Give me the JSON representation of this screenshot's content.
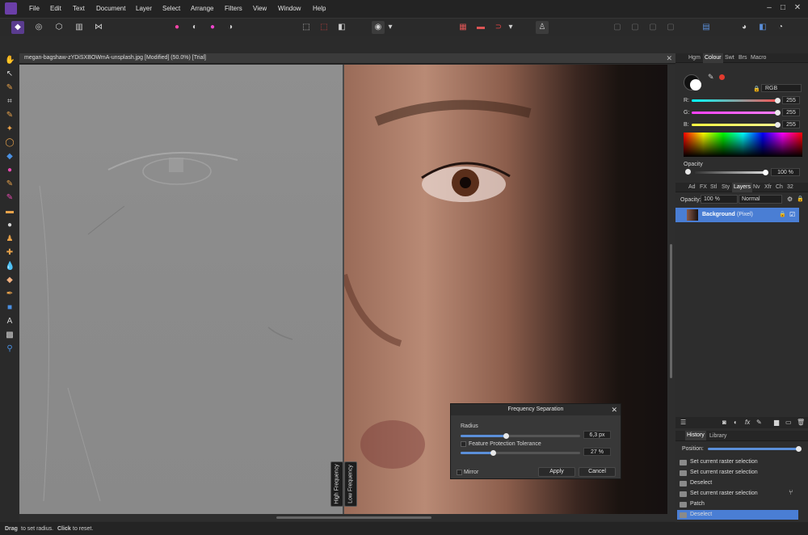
{
  "menu": {
    "items": [
      "File",
      "Edit",
      "Text",
      "Document",
      "Layer",
      "Select",
      "Arrange",
      "Filters",
      "View",
      "Window",
      "Help"
    ]
  },
  "document": {
    "tab_title": "megan-bagshaw-zYDiSXBOWmA-unsplash.jpg [Modified] (50.0%) [Trial]"
  },
  "preview_labels": {
    "high": "High Frequency",
    "low": "Low Frequency"
  },
  "dialog": {
    "title": "Frequency Separation",
    "radius_label": "Radius",
    "radius_value": "6,3 px",
    "radius_fraction": 0.38,
    "tolerance_label": "Feature Protection Tolerance",
    "tolerance_value": "27 %",
    "tolerance_fraction": 0.27,
    "mirror_label": "Mirror",
    "apply_label": "Apply",
    "cancel_label": "Cancel"
  },
  "colour_panel": {
    "tabs": [
      "Hgm",
      "Colour",
      "Swt",
      "Brs",
      "Macro"
    ],
    "active_tab": "Colour",
    "mode": "RGB",
    "channels": [
      {
        "label": "R:",
        "value": "255",
        "color": "#ff5050"
      },
      {
        "label": "G:",
        "value": "255",
        "color": "#3adf3a"
      },
      {
        "label": "B:",
        "value": "255",
        "color": "#4a7dff"
      }
    ],
    "opacity_label": "Opacity",
    "opacity_value": "100 %"
  },
  "layers_panel": {
    "tabs": [
      "Ad",
      "FX",
      "Stl",
      "Sty",
      "Layers",
      "Nv",
      "Xfr",
      "Ch",
      "32"
    ],
    "active_tab": "Layers",
    "opacity_label": "Opacity:",
    "opacity_value": "100 %",
    "blend_mode": "Normal",
    "layer_name": "Background",
    "layer_type": "(Pixel)"
  },
  "history_panel": {
    "tabs": [
      "History",
      "Library"
    ],
    "active_tab": "History",
    "position_label": "Position:",
    "items": [
      "Set current raster selection",
      "Set current raster selection",
      "Deselect",
      "Set current raster selection",
      "Patch",
      "Deselect"
    ],
    "selected_index": 5
  },
  "status": {
    "part1": "Drag",
    "part2": " to set radius. ",
    "part3": "Click",
    "part4": " to reset."
  },
  "colors": {
    "accent": "#4a7ed4",
    "selection": "#5b8fd9"
  }
}
